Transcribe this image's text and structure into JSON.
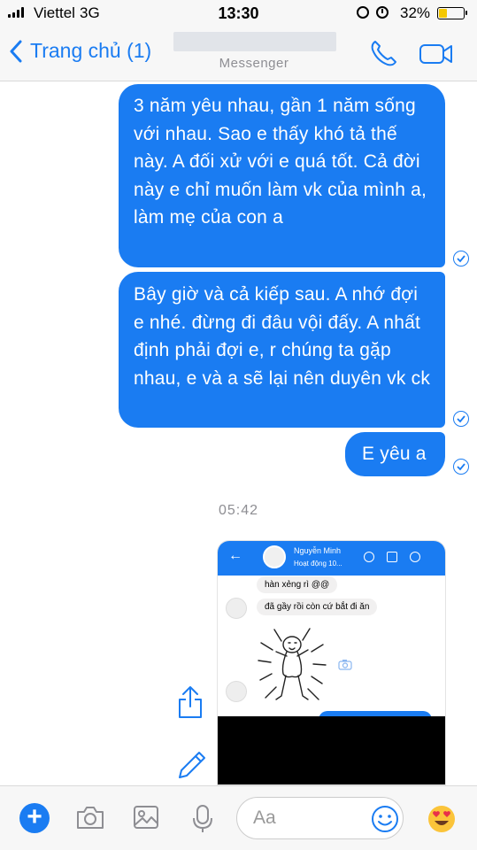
{
  "status_bar": {
    "carrier": "Viettel",
    "network": "3G",
    "time": "13:30",
    "battery_percent": "32%",
    "battery_level": 0.32,
    "icons": [
      "signal-icon",
      "rotation-lock-icon",
      "alarm-icon",
      "battery-icon"
    ]
  },
  "nav": {
    "back_label": "Trang chủ (1)",
    "subtitle": "Messenger",
    "icons": [
      "back-chevron-icon",
      "phone-icon",
      "video-camera-icon"
    ]
  },
  "messages": [
    {
      "text": "3 năm yêu nhau, gần 1 năm sống với nhau. Sao e thấy khó tả thế này. A đối xử với e quá tốt. Cả đời này e chỉ muốn làm vk của mình a, làm mẹ của con a"
    },
    {
      "text": "Bây giờ và cả kiếp sau. A nhớ đợi e nhé. đừng đi đâu vội đấy. A nhất định phải đợi e, r chúng ta gặp nhau, e và a sẽ lại nên duyên vk ck"
    },
    {
      "text": "E yêu a"
    }
  ],
  "timestamp": "05:42",
  "attachment": {
    "contact_name": "Nguyễn Minh",
    "contact_status": "Hoạt động 10...",
    "messages": [
      "hàn xẻng rì @@",
      "đã gầy rồi còn cứ bắt đi ăn"
    ]
  },
  "composer": {
    "placeholder": "Aa",
    "icons": [
      "plus-icon",
      "camera-icon",
      "gallery-icon",
      "microphone-icon",
      "smiley-icon",
      "heart-eyes-emoji-icon"
    ]
  },
  "colors": {
    "accent": "#1a7cf2",
    "bar_bg": "#f7f7f7"
  }
}
